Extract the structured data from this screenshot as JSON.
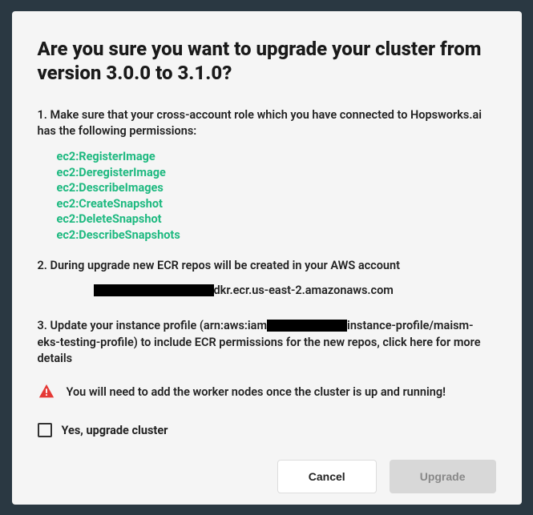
{
  "title": "Are you sure you want to upgrade your cluster from version 3.0.0 to 3.1.0?",
  "step1": "1. Make sure that your cross-account role which you have connected to Hopsworks.ai has the following permissions:",
  "permissions": [
    "ec2:RegisterImage",
    "ec2:DeregisterImage",
    "ec2:DescribeImages",
    "ec2:CreateSnapshot",
    "ec2:DeleteSnapshot",
    "ec2:DescribeSnapshots"
  ],
  "step2": "2. During upgrade new ECR repos will be created in your AWS account",
  "ecr_suffix": "dkr.ecr.us-east-2.amazonaws.com",
  "step3_a": "3. Update your instance profile (arn:aws:iam",
  "step3_b": "instance-profile/maism-eks-testing-profile) to include ECR permissions for the new repos, click here for more details",
  "warning": "You will need to add the worker nodes once the cluster is up and running!",
  "checkbox_label": "Yes, upgrade cluster",
  "buttons": {
    "cancel": "Cancel",
    "upgrade": "Upgrade"
  }
}
